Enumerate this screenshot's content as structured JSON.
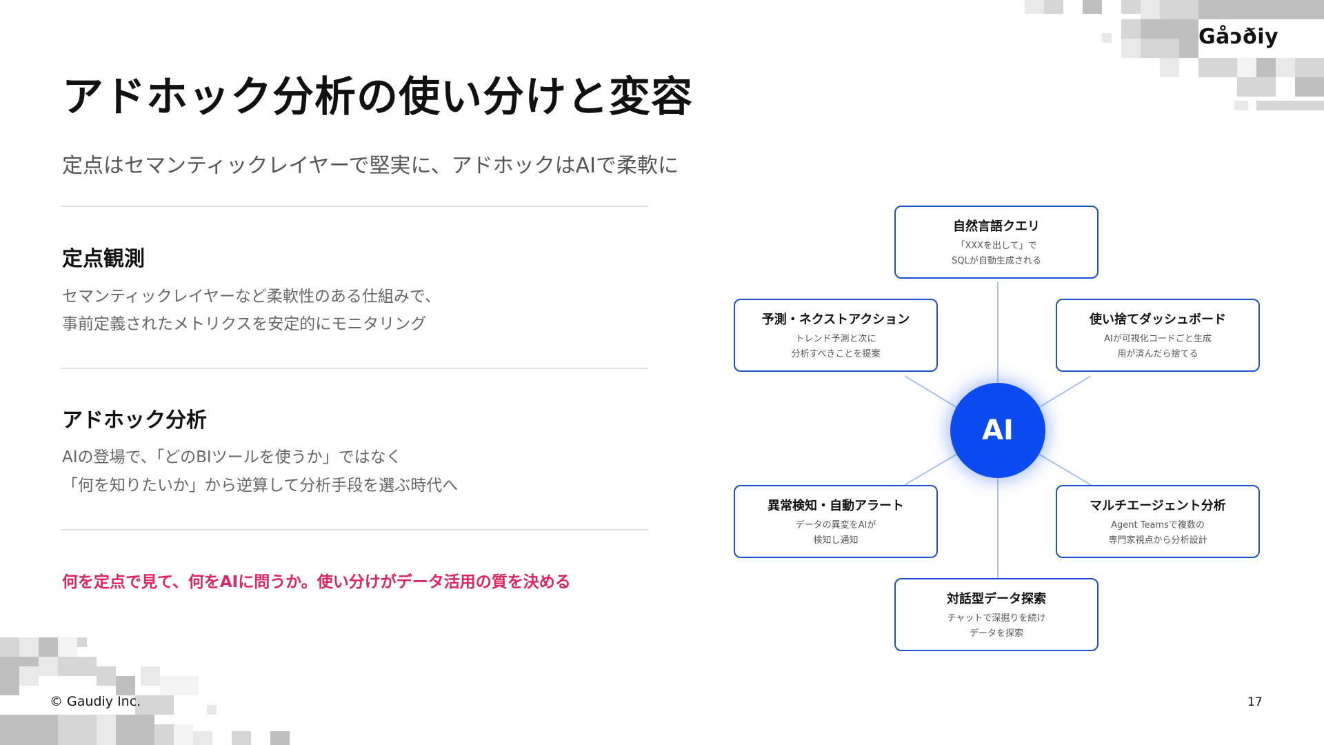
{
  "brand": {
    "logo_text": "Gåɔði̇y"
  },
  "slide": {
    "title": "アドホック分析の使い分けと変容",
    "subtitle": "定点はセマンティックレイヤーで堅実に、アドホックはAIで柔軟に"
  },
  "sections": [
    {
      "title": "定点観測",
      "lines": [
        "セマンティックレイヤーなど柔軟性のある仕組みで、",
        "事前定義されたメトリクスを安定的にモニタリング"
      ]
    },
    {
      "title": "アドホック分析",
      "lines": [
        "AIの登場で、「どのBIツールを使うか」ではなく",
        "「何を知りたいか」から逆算して分析手段を選ぶ時代へ"
      ]
    }
  ],
  "emphasis": "何を定点で見て、何をAIに問うか。使い分けがデータ活用の質を決める",
  "diagram": {
    "center_label": "AI",
    "accent_color": "#0b4cf0",
    "border_color": "#1a4fd1",
    "nodes": [
      {
        "title": "自然言語クエリ",
        "lines": [
          "「XXXを出して」で",
          "SQLが自動生成される"
        ]
      },
      {
        "title": "予測・ネクストアクション",
        "lines": [
          "トレンド予測と次に",
          "分析すべきことを提案"
        ]
      },
      {
        "title": "使い捨てダッシュボード",
        "lines": [
          "AIが可視化コードごと生成",
          "用が済んだら捨てる"
        ]
      },
      {
        "title": "異常検知・自動アラート",
        "lines": [
          "データの異変をAIが",
          "検知し通知"
        ]
      },
      {
        "title": "マルチエージェント分析",
        "lines": [
          "Agent Teamsで複数の",
          "専門家視点から分析設計"
        ]
      },
      {
        "title": "対話型データ探索",
        "lines": [
          "チャットで深掘りを続け",
          "データを探索"
        ]
      }
    ]
  },
  "footer": {
    "copyright": "© Gaudiy Inc.",
    "page_number": "17"
  },
  "emphasis_color": "#e0245e"
}
